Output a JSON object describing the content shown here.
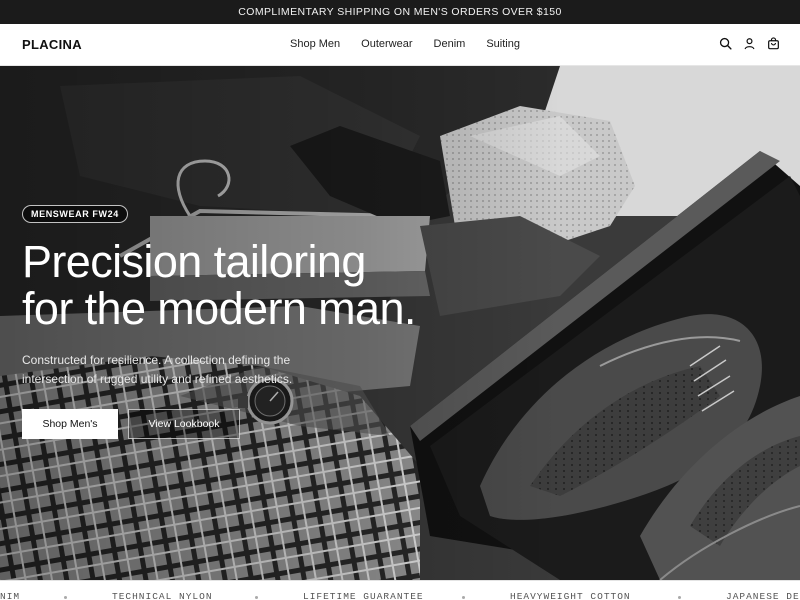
{
  "announcement": {
    "text": "COMPLIMENTARY SHIPPING ON MEN'S ORDERS OVER $150"
  },
  "header": {
    "logo": "PLACINA",
    "nav": [
      {
        "label": "Shop Men"
      },
      {
        "label": "Outerwear"
      },
      {
        "label": "Denim"
      },
      {
        "label": "Suiting"
      }
    ],
    "icons": [
      "search-icon",
      "account-icon",
      "cart-icon"
    ]
  },
  "hero": {
    "badge": "MENSWEAR FW24",
    "headline": [
      "Precision tailoring",
      "for the modern man."
    ],
    "subtext": [
      "Constructed for resilience. A collection defining the",
      "intersection of rugged utility and refined aesthetics."
    ],
    "primary_button": "Shop Men's",
    "secondary_button": "View Lookbook"
  },
  "marquee": {
    "items": [
      "NIM",
      "TECHNICAL NYLON",
      "LIFETIME GUARANTEE",
      "HEAVYWEIGHT COTTON",
      "JAPANESE DE"
    ]
  },
  "colors": {
    "announcement_bg": "#1b1b1b",
    "header_bg": "#ffffff",
    "primary_button_bg": "#ffffff",
    "text_on_hero": "#ffffff"
  }
}
